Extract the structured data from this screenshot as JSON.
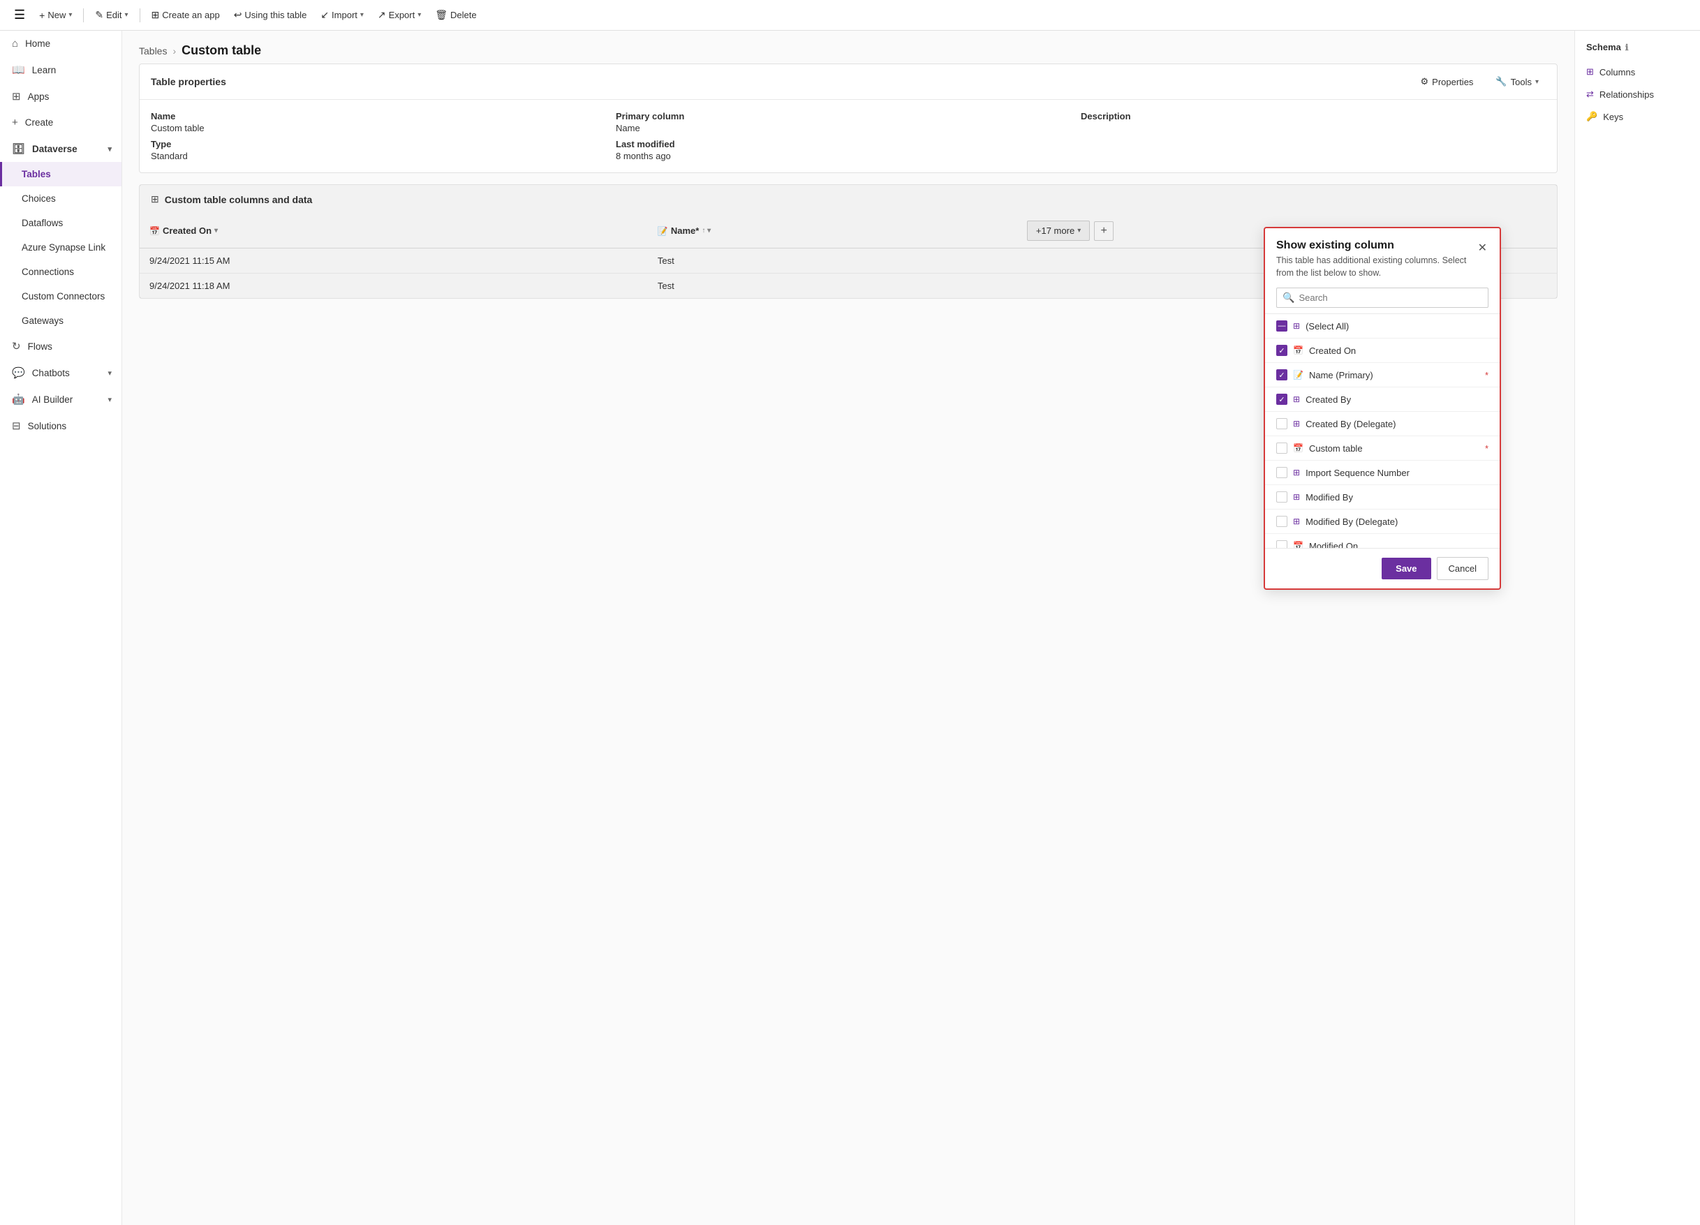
{
  "toolbar": {
    "hamburger": "☰",
    "new_label": "New",
    "edit_label": "Edit",
    "create_app_label": "Create an app",
    "using_this_table_label": "Using this table",
    "import_label": "Import",
    "export_label": "Export",
    "delete_label": "Delete"
  },
  "sidebar": {
    "items": [
      {
        "id": "home",
        "label": "Home",
        "icon": "⌂"
      },
      {
        "id": "learn",
        "label": "Learn",
        "icon": "📖"
      },
      {
        "id": "apps",
        "label": "Apps",
        "icon": "⊞"
      },
      {
        "id": "create",
        "label": "Create",
        "icon": "+"
      },
      {
        "id": "dataverse",
        "label": "Dataverse",
        "icon": "🗄",
        "expandable": true,
        "expanded": true
      },
      {
        "id": "tables",
        "label": "Tables",
        "icon": "",
        "active": true,
        "sub": true
      },
      {
        "id": "choices",
        "label": "Choices",
        "icon": "",
        "sub": true
      },
      {
        "id": "dataflows",
        "label": "Dataflows",
        "icon": "",
        "sub": true
      },
      {
        "id": "azure-synapse",
        "label": "Azure Synapse Link",
        "icon": "",
        "sub": true
      },
      {
        "id": "connections",
        "label": "Connections",
        "icon": "",
        "sub": true
      },
      {
        "id": "custom-connectors",
        "label": "Custom Connectors",
        "icon": "",
        "sub": true
      },
      {
        "id": "gateways",
        "label": "Gateways",
        "icon": "",
        "sub": true
      },
      {
        "id": "flows",
        "label": "Flows",
        "icon": "↻"
      },
      {
        "id": "chatbots",
        "label": "Chatbots",
        "icon": "💬",
        "expandable": true
      },
      {
        "id": "ai-builder",
        "label": "AI Builder",
        "icon": "🤖",
        "expandable": true
      },
      {
        "id": "solutions",
        "label": "Solutions",
        "icon": "⊟"
      }
    ]
  },
  "breadcrumb": {
    "parent": "Tables",
    "current": "Custom table"
  },
  "table_properties": {
    "card_title": "Table properties",
    "properties_btn": "Properties",
    "tools_btn": "Tools",
    "fields": [
      {
        "label": "Name",
        "value": "Custom table"
      },
      {
        "label": "Primary column",
        "value": "Name"
      },
      {
        "label": "Description",
        "value": ""
      }
    ],
    "fields2": [
      {
        "label": "Type",
        "value": "Standard"
      },
      {
        "label": "Last modified",
        "value": "8 months ago"
      }
    ]
  },
  "data_section": {
    "title": "Custom table columns and data",
    "columns": [
      {
        "id": "created-on",
        "label": "Created On"
      },
      {
        "id": "name",
        "label": "Name*"
      }
    ],
    "rows": [
      {
        "created_on": "9/24/2021 11:15 AM",
        "name": "Test"
      },
      {
        "created_on": "9/24/2021 11:18 AM",
        "name": "Test"
      }
    ],
    "more_btn": "+17 more"
  },
  "schema_panel": {
    "title": "Schema",
    "info_icon": "ℹ",
    "items": [
      {
        "id": "columns",
        "label": "Columns",
        "icon": "⊞"
      },
      {
        "id": "relationships",
        "label": "Relationships",
        "icon": "⇄"
      },
      {
        "id": "keys",
        "label": "Keys",
        "icon": "🔑"
      }
    ]
  },
  "modal": {
    "title": "Show existing column",
    "subtitle": "This table has additional existing columns. Select from the list below to show.",
    "search_placeholder": "Search",
    "items": [
      {
        "id": "select-all",
        "label": "(Select All)",
        "icon": "⊞",
        "checked": "indeterminate",
        "required": false
      },
      {
        "id": "created-on",
        "label": "Created On",
        "icon": "📅",
        "checked": true,
        "required": false
      },
      {
        "id": "name-primary",
        "label": "Name (Primary)",
        "icon": "📝",
        "checked": true,
        "required": true
      },
      {
        "id": "created-by",
        "label": "Created By",
        "icon": "⊞",
        "checked": true,
        "required": false
      },
      {
        "id": "created-by-delegate",
        "label": "Created By (Delegate)",
        "icon": "⊞",
        "checked": false,
        "required": false
      },
      {
        "id": "custom-table",
        "label": "Custom table",
        "icon": "📅",
        "checked": false,
        "required": true
      },
      {
        "id": "import-seq",
        "label": "Import Sequence Number",
        "icon": "⊞",
        "checked": false,
        "required": false
      },
      {
        "id": "modified-by",
        "label": "Modified By",
        "icon": "⊞",
        "checked": false,
        "required": false
      },
      {
        "id": "modified-by-delegate",
        "label": "Modified By (Delegate)",
        "icon": "⊞",
        "checked": false,
        "required": false
      },
      {
        "id": "modified-on",
        "label": "Modified On",
        "icon": "📅",
        "checked": false,
        "required": false
      }
    ],
    "save_btn": "Save",
    "cancel_btn": "Cancel"
  }
}
